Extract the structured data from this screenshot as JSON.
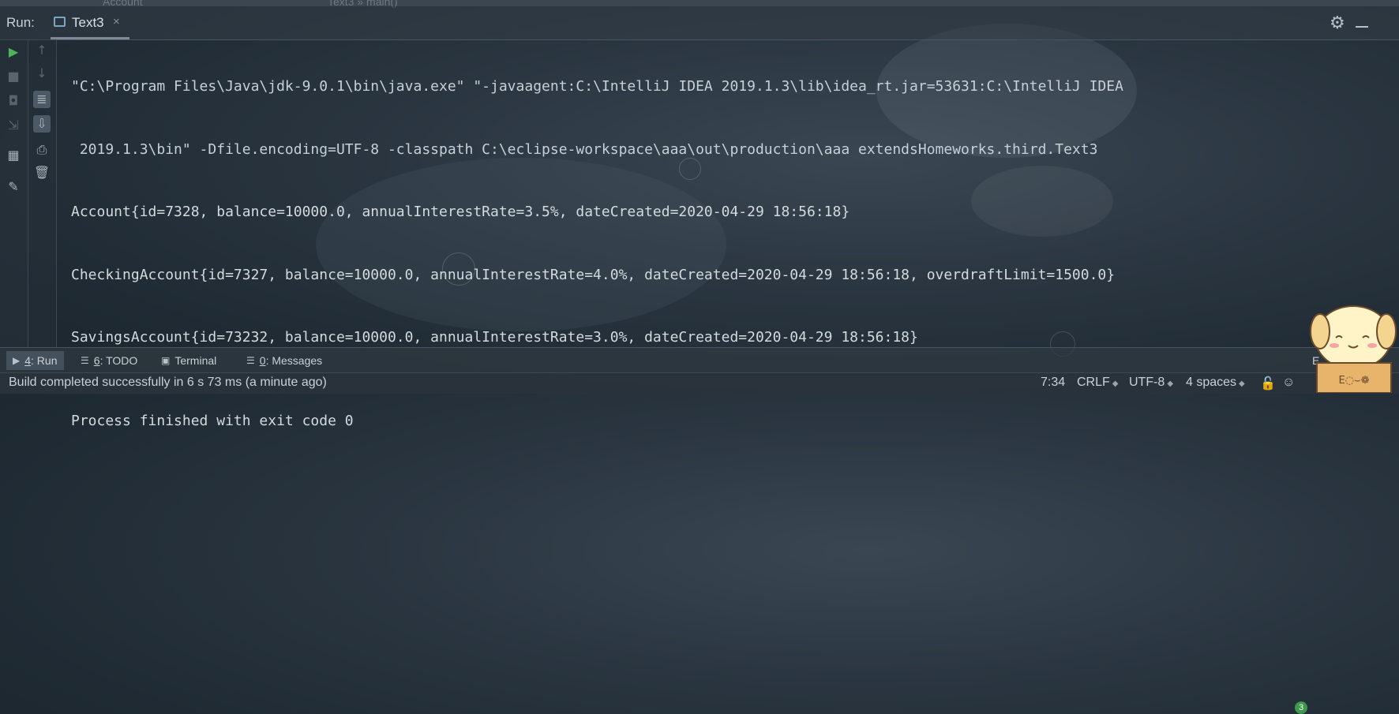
{
  "top_strip": {
    "ghost_left": "Account",
    "ghost_right": "Text3 » main()"
  },
  "run_panel": {
    "run_label": "Run:",
    "tab_label": "Text3",
    "tab_close": "×",
    "settings_icon": "gear-icon",
    "minimize_icon": "minimize-icon"
  },
  "left_toolbar": {
    "primary": [
      "run-icon",
      "stop-icon",
      "camera-icon",
      "exit-icon",
      "layout-icon",
      "pin-icon"
    ],
    "secondary": [
      "up-arrow-icon",
      "down-arrow-icon",
      "soft-wrap-icon",
      "scroll-to-end-icon",
      "print-icon",
      "trash-icon"
    ]
  },
  "console": {
    "lines": [
      "\"C:\\Program Files\\Java\\jdk-9.0.1\\bin\\java.exe\" \"-javaagent:C:\\IntelliJ IDEA 2019.1.3\\lib\\idea_rt.jar=53631:C:\\IntelliJ IDEA",
      " 2019.1.3\\bin\" -Dfile.encoding=UTF-8 -classpath C:\\eclipse-workspace\\aaa\\out\\production\\aaa extendsHomeworks.third.Text3",
      "Account{id=7328, balance=10000.0, annualInterestRate=3.5%, dateCreated=2020-04-29 18:56:18}",
      "CheckingAccount{id=7327, balance=10000.0, annualInterestRate=4.0%, dateCreated=2020-04-29 18:56:18, overdraftLimit=1500.0}",
      "SavingsAccount{id=73232, balance=10000.0, annualInterestRate=3.0%, dateCreated=2020-04-29 18:56:18}"
    ],
    "exit_line": "Process finished with exit code 0"
  },
  "tool_windows": [
    {
      "key": "4",
      "label": ": Run"
    },
    {
      "key": "6",
      "label": ": TODO"
    },
    {
      "key": "",
      "label": "Terminal"
    },
    {
      "key": "0",
      "label": ": Messages"
    }
  ],
  "event_log": {
    "icon": "event-log-icon",
    "badge": "3",
    "label": "E"
  },
  "status_bar": {
    "message": "Build completed successfully in 6 s 73 ms (a minute ago)",
    "position": "7:34",
    "line_separator": "CRLF",
    "encoding": "UTF-8",
    "indent": "4 spaces",
    "lock_icon": "lock-icon",
    "inspector_icon": "inspector-icon"
  },
  "mascot": {
    "icon": "dog-mascot-icon",
    "box_text": "E◌⌣❁"
  }
}
